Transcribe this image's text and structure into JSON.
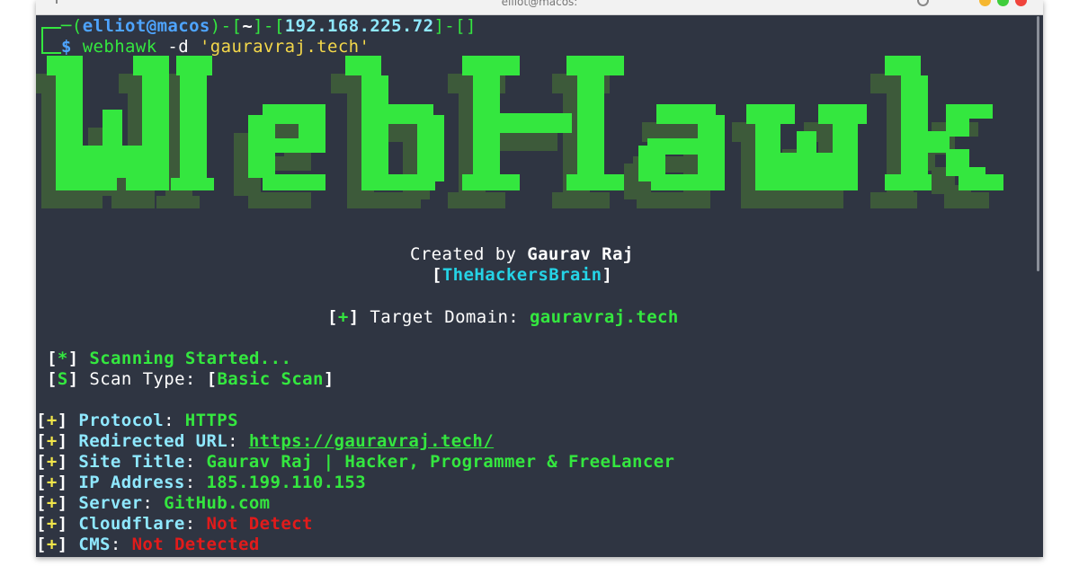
{
  "window": {
    "title": "elliot@macos:"
  },
  "prompt": {
    "user": "elliot",
    "host": "macos",
    "dir": "~",
    "ip": "192.168.225.72",
    "extra": "",
    "symbol": "$",
    "command": "webhawk",
    "flag": "-d",
    "arg": "'gauravraj.tech'"
  },
  "banner": {
    "text": "WebHawk"
  },
  "credits": {
    "created_by_label": "Created by",
    "author": "Gaurav Raj",
    "team": "TheHackersBrain"
  },
  "target": {
    "marker": "+",
    "label": "Target Domain:",
    "value": "gauravraj.tech"
  },
  "scan": {
    "started_marker": "*",
    "started_text": "Scanning Started...",
    "type_marker": "S",
    "type_label": "Scan Type:",
    "type_value": "Basic Scan"
  },
  "results": [
    {
      "marker": "+",
      "label": "Protocol",
      "value": "HTTPS",
      "status": "ok"
    },
    {
      "marker": "+",
      "label": "Redirected URL",
      "value": "https://gauravraj.tech/",
      "status": "link"
    },
    {
      "marker": "+",
      "label": "Site Title",
      "value": "Gaurav Raj | Hacker, Programmer & FreeLancer",
      "status": "ok"
    },
    {
      "marker": "+",
      "label": "IP Address",
      "value": "185.199.110.153",
      "status": "ok"
    },
    {
      "marker": "+",
      "label": "Server",
      "value": "GitHub.com",
      "status": "ok"
    },
    {
      "marker": "+",
      "label": "Cloudflare",
      "value": "Not Detect",
      "status": "bad"
    },
    {
      "marker": "+",
      "label": "CMS",
      "value": "Not Detected",
      "status": "bad"
    }
  ],
  "colors": {
    "background": "#2f3542",
    "accent_green": "#34e73f",
    "shadow_green": "#3d5a3a",
    "yellow": "#f2e64a",
    "cyan": "#8fe8ff",
    "red": "#e11b1b"
  }
}
